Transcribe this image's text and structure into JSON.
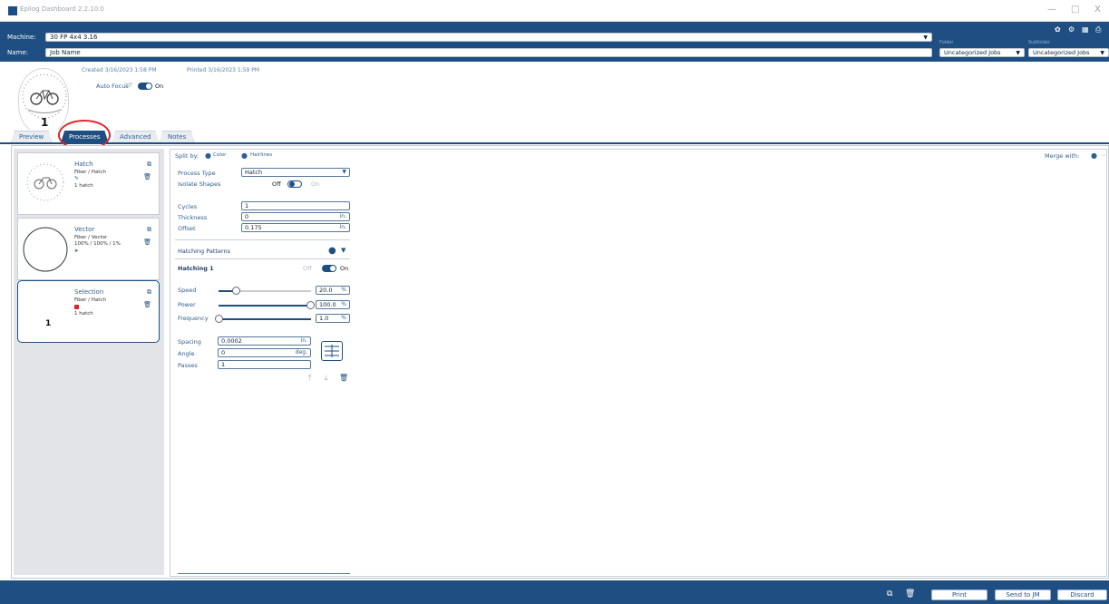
{
  "window": {
    "title": "Epilog Dashboard 2.2.10.0",
    "controls": [
      "—",
      "□",
      "X"
    ]
  },
  "header": {
    "machine_label": "Machine:",
    "machine_value": "30 FP 4x4 3.16",
    "name_label": "Name:",
    "name_value": "Job Name",
    "folder_label": "Folder",
    "folder_value": "Uncategorized Jobs",
    "subfolder_label": "Subfolder",
    "subfolder_value": "Uncategorized Jobs",
    "icons": [
      "gear-icon",
      "settings-icon",
      "grid-icon",
      "printer-icon"
    ]
  },
  "job": {
    "created": "Created 3/16/2023 1:58 PM",
    "printed": "Printed 3/16/2023 1:59 PM",
    "autofocus_label": "Auto Focus",
    "autofocus_off": "Off",
    "autofocus_on": "On",
    "thumb_number": "1"
  },
  "tabs": [
    {
      "label": "Preview",
      "active": false
    },
    {
      "label": "Processes",
      "active": true
    },
    {
      "label": "Advanced",
      "active": false
    },
    {
      "label": "Notes",
      "active": false
    }
  ],
  "processes": [
    {
      "title": "Hatch",
      "sub1": "Fiber / Hatch",
      "sub2": "1 hatch"
    },
    {
      "title": "Vector",
      "sub1": "Fiber / Vector",
      "sub2": "100% / 100% / 1%"
    },
    {
      "title": "Selection",
      "sub1": "Fiber / Hatch",
      "sub2": "1 hatch",
      "number": "1"
    }
  ],
  "editor": {
    "split_by_label": "Split by:",
    "split_color": "Color",
    "split_hairlines": "Hairlines",
    "merge_with": "Merge with:",
    "process_type_label": "Process Type",
    "process_type_value": "Hatch",
    "isolate_label": "Isolate Shapes",
    "isolate_off": "Off",
    "isolate_on": "On",
    "cycles_label": "Cycles",
    "cycles_value": "1",
    "thickness_label": "Thickness",
    "thickness_value": "0",
    "thickness_unit": "in.",
    "offset_label": "Offset",
    "offset_value": "0.175",
    "offset_unit": "in.",
    "patterns_label": "Hatching Patterns",
    "hatch_name": "Hatching 1",
    "hatch_off": "Off",
    "hatch_on": "On",
    "speed_label": "Speed",
    "speed_value": "20.0",
    "speed_level": 0.2,
    "power_label": "Power",
    "power_value": "100.0",
    "power_level": 1.0,
    "frequency_label": "Frequency",
    "frequency_value": "1.0",
    "frequency_level": 0.01,
    "pct": "%",
    "spacing_label": "Spacing",
    "spacing_value": "0.0002",
    "spacing_unit": "in.",
    "angle_label": "Angle",
    "angle_value": "0",
    "angle_unit": "deg.",
    "passes_label": "Passes",
    "passes_value": "1"
  },
  "footer": {
    "print": "Print",
    "send": "Send to JM",
    "discard": "Discard"
  },
  "colors": {
    "brand": "#1f4f82",
    "highlight": "#d9262c"
  }
}
